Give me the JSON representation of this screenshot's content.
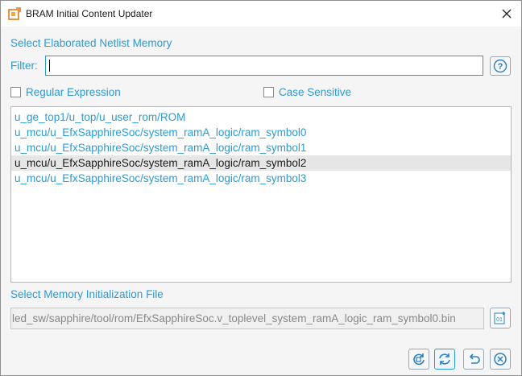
{
  "window": {
    "title": "BRAM Initial Content Updater"
  },
  "netlist": {
    "heading": "Select Elaborated Netlist Memory",
    "filter_label": "Filter:",
    "filter_value": "",
    "help_label": "?",
    "regex_label": "Regular Expression",
    "regex_checked": false,
    "case_label": "Case Sensitive",
    "case_checked": false,
    "items": [
      {
        "label": "u_ge_top1/u_top/u_user_rom/ROM",
        "selected": false
      },
      {
        "label": "u_mcu/u_EfxSapphireSoc/system_ramA_logic/ram_symbol0",
        "selected": false
      },
      {
        "label": "u_mcu/u_EfxSapphireSoc/system_ramA_logic/ram_symbol1",
        "selected": false
      },
      {
        "label": "u_mcu/u_EfxSapphireSoc/system_ramA_logic/ram_symbol2",
        "selected": true
      },
      {
        "label": "u_mcu/u_EfxSapphireSoc/system_ramA_logic/ram_symbol3",
        "selected": false
      }
    ]
  },
  "memfile": {
    "heading": "Select Memory Initialization File",
    "path": "led_sw/sapphire/tool/rom/EfxSapphireSoc.v_toplevel_system_ramA_logic_ram_symbol0.bin",
    "browse_icon_text": "01"
  },
  "actions": [
    {
      "name": "refresh-all-icon"
    },
    {
      "name": "refresh-icon"
    },
    {
      "name": "undo-icon"
    },
    {
      "name": "cancel-icon"
    }
  ],
  "colors": {
    "accent": "#2a9bd3",
    "selection": "#e6e6e6"
  }
}
